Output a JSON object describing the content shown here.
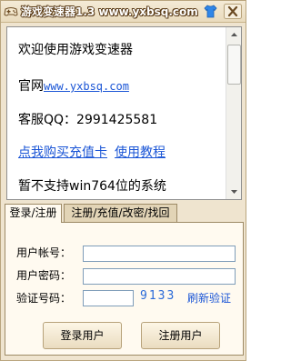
{
  "window": {
    "title": "游戏变速器1.3  www.yxbsq.com"
  },
  "notice": {
    "welcome": "欢迎使用游戏变速器",
    "website_label": "官网",
    "website_link": "www.yxbsq.com",
    "support_qq": "客服QQ：2991425581",
    "buy_card_link": "点我购买充值卡",
    "tutorial_link": "使用教程",
    "warning": "暂不支持win764位的系统"
  },
  "tabs": [
    {
      "label": "登录/注册",
      "active": true
    },
    {
      "label": "注册/充值/改密/找回",
      "active": false
    }
  ],
  "login_form": {
    "username_label": "用户帐号：",
    "username_value": "",
    "password_label": "用户密码：",
    "password_value": "",
    "captcha_label": "验证号码：",
    "captcha_value": "",
    "captcha_code": "9133",
    "refresh_label": "刷新验证",
    "login_button": "登录用户",
    "register_button": "注册用户"
  },
  "colors": {
    "link": "#1a55d6",
    "captcha": "#2a6ad8",
    "window_bg": "#efe4cf",
    "skin_button": "#2f86e8",
    "close_button": "#6b4a22"
  },
  "icons": {
    "app": "game-controller-icon",
    "skin": "shirt-icon",
    "close": "close-icon"
  }
}
